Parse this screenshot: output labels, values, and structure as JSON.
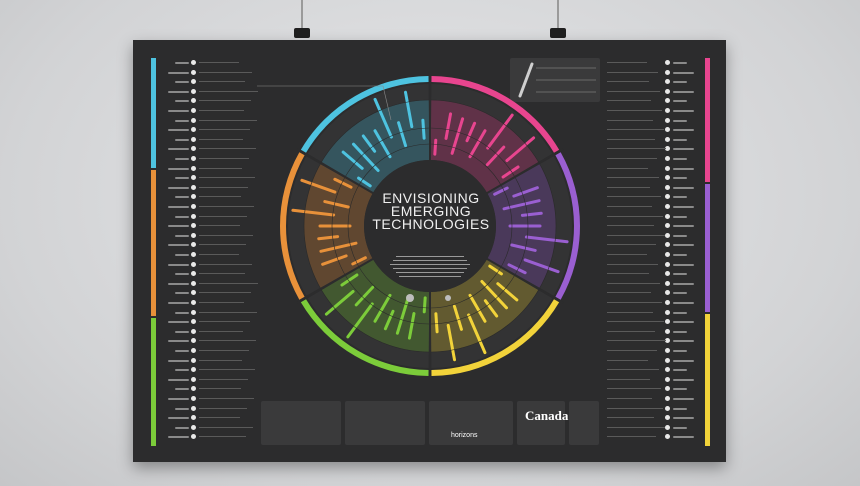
{
  "title": "ENVISIONING EMERGING TECHNOLOGIES",
  "title_lines": [
    "ENVISIONING",
    "EMERGING",
    "TECHNOLOGIES"
  ],
  "footer_logo": "Canada",
  "partner_logo": "horizons",
  "colors": {
    "wall": "#d7d8da",
    "poster": "#2c2c2d",
    "blue": "#4ec3e0",
    "pink": "#e8458f",
    "purple": "#9a5fd1",
    "yellow": "#f2d33a",
    "green": "#7ccc3a",
    "orange": "#e8913a"
  },
  "segments": [
    {
      "color_key": "blue"
    },
    {
      "color_key": "pink"
    },
    {
      "color_key": "purple"
    },
    {
      "color_key": "yellow"
    },
    {
      "color_key": "green"
    },
    {
      "color_key": "orange"
    }
  ]
}
